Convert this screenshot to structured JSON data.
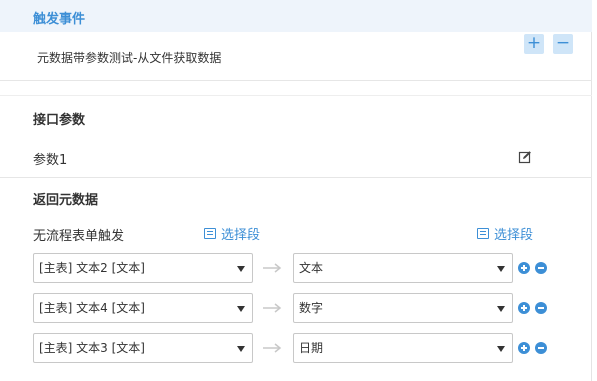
{
  "trigger": {
    "title": "触发事件",
    "item": "元数据带参数测试-从文件获取数据",
    "add_label": "+",
    "remove_label": "−"
  },
  "interface": {
    "title": "接口参数",
    "param_label": "参数1",
    "edit_icon": "edit-icon"
  },
  "return_meta": {
    "title": "返回元数据",
    "noflow_label": "无流程表单触发",
    "choose_left": "选择段",
    "choose_right": "选择段",
    "rows": [
      {
        "source": "[主表] 文本2 [文本]",
        "target": "文本"
      },
      {
        "source": "[主表] 文本4 [文本]",
        "target": "数字"
      },
      {
        "source": "[主表] 文本3 [文本]",
        "target": "日期"
      }
    ]
  },
  "colors": {
    "accent": "#3d8fd6",
    "header_bg": "#eef4fb",
    "button_bg": "#cfe5f8"
  }
}
